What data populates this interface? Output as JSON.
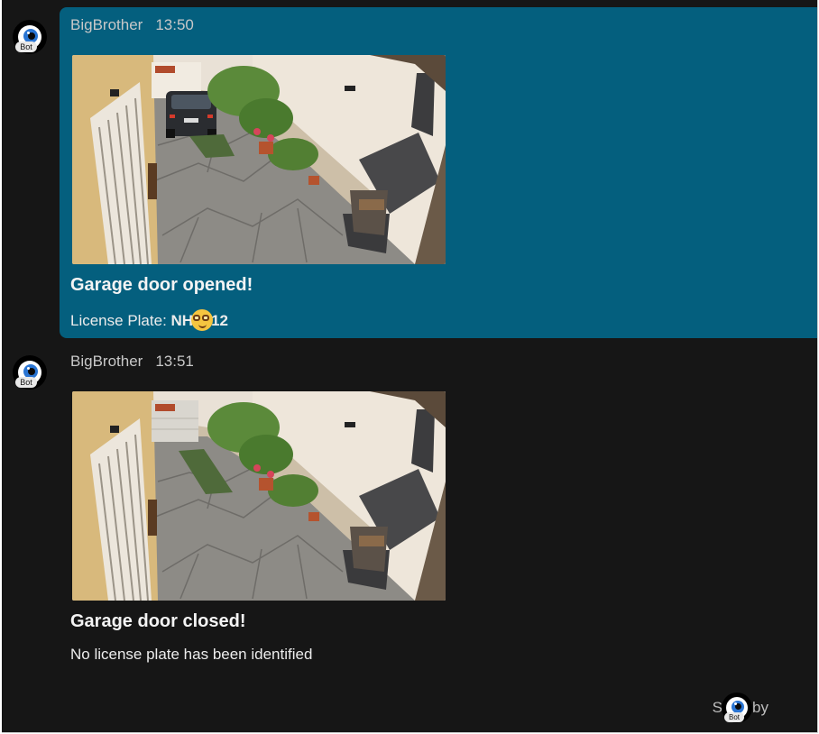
{
  "messages": [
    {
      "sender": "BigBrother",
      "time": "13:50",
      "avatar_badge": "Bot",
      "avatar_icon": "eye-icon",
      "camera_image": "garage-camera-door-open-car-present",
      "title": "Garage door opened!",
      "body_label": "License Plate: ",
      "plate_prefix": "NH",
      "plate_emoji": "nerd-face-emoji",
      "plate_suffix": "12",
      "highlight_color": "#045f7e"
    },
    {
      "sender": "BigBrother",
      "time": "13:51",
      "avatar_badge": "Bot",
      "avatar_icon": "eye-icon",
      "camera_image": "garage-camera-door-closed-empty",
      "title": "Garage door closed!",
      "body": "No license plate has been identified"
    }
  ],
  "read_receipt": {
    "label": "Seen by",
    "avatar_badge": "Bot"
  }
}
